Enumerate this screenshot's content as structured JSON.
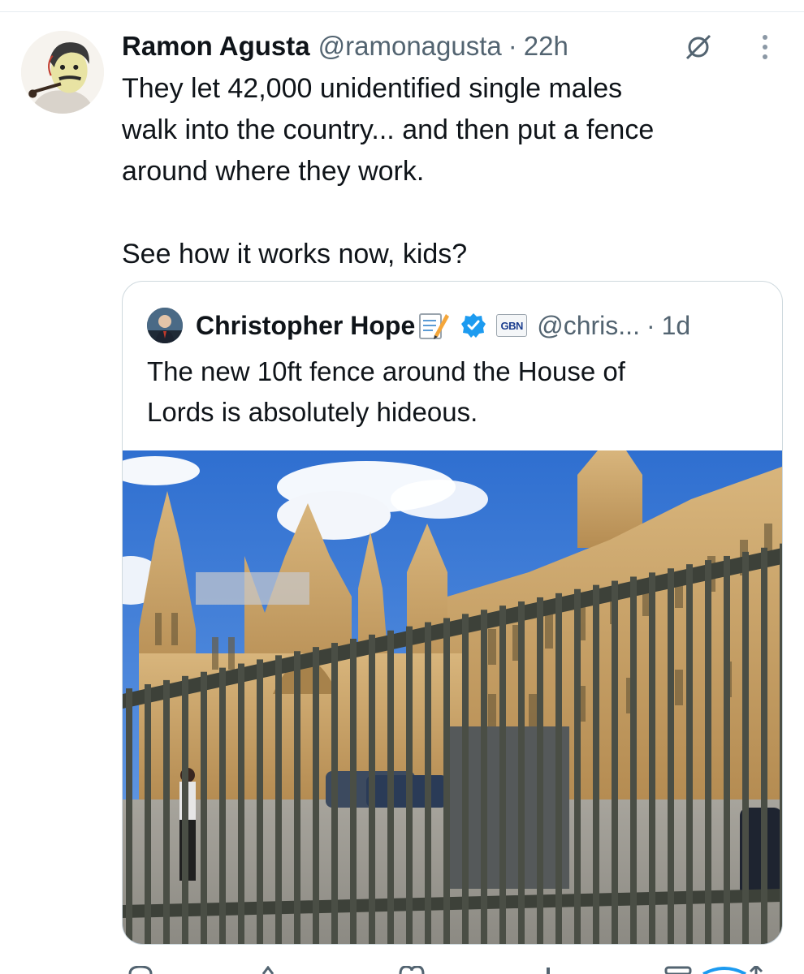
{
  "tweet": {
    "author_name": "Ramon Agusta",
    "handle": "@ramonagusta",
    "separator": "·",
    "time": "22h",
    "avatar_icon": "caricature-avatar",
    "text_lines": [
      "They let 42,000 unidentified single males",
      "walk into the country... and then put a fence",
      "around where they work.",
      "",
      "See how it works now, kids?"
    ]
  },
  "quote": {
    "author_name": "Christopher Hope",
    "emoji_icon": "memo-icon",
    "verified_icon": "verified-badge-icon",
    "affiliate_badge": "GBN",
    "handle": "@chris...",
    "separator": "·",
    "time": "1d",
    "text_lines": [
      "The new 10ft fence around the House of",
      "Lords is absolutely hideous."
    ],
    "photo_description_icon": "photo"
  },
  "colors": {
    "text": "#0f1419",
    "secondary": "#536471",
    "border": "#cfd9de",
    "verified": "#1d9bf0"
  }
}
